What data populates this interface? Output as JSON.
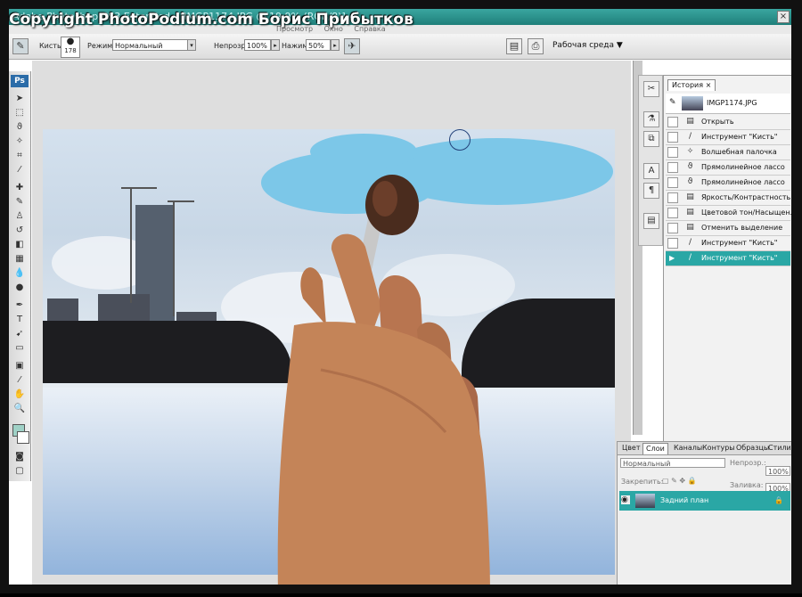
{
  "watermark": "Copyright PhotoPodium.com Борис Прибытков",
  "window": {
    "title": "Adobe Photoshop CS3 Extended - [IMGP1174.JPG @ 19,9% (RGB/8)]"
  },
  "menubar": {
    "items": [
      "Просмотр",
      "Окно",
      "Справка"
    ]
  },
  "options_bar": {
    "brush_label": "Кисть:",
    "brush_size": "178",
    "mode_label": "Режим:",
    "mode_value": "Нормальный",
    "opacity_label": "Непрозр.:",
    "opacity_value": "100%",
    "flow_label": "Нажим:",
    "flow_value": "50%",
    "workspace_label": "Рабочая среда ▼"
  },
  "toolbox": {
    "logo": "Ps"
  },
  "history_panel": {
    "tab_label": "История",
    "snapshot_name": "IMGP1174.JPG",
    "states": [
      "Открыть",
      "Инструмент \"Кисть\"",
      "Волшебная палочка",
      "Прямолинейное лассо",
      "Прямолинейное лассо",
      "Яркость/Контрастность",
      "Цветовой тон/Насыщен...",
      "Отменить выделение",
      "Инструмент \"Кисть\"",
      "Инструмент \"Кисть\""
    ],
    "selected_index": 9
  },
  "layers_panel": {
    "tabs": [
      "Цвет",
      "Слои",
      "Каналы",
      "Контуры",
      "Образцы",
      "Стили"
    ],
    "active_tab": "Слои",
    "blend_mode": "Нормальный",
    "opacity_label": "Непрозр.:",
    "opacity_value": "100%",
    "lock_label": "Закрепить:",
    "fill_label": "Заливка:",
    "fill_value": "100%",
    "layer_name": "Задний план"
  },
  "colors": {
    "accent_teal": "#2aa7a5",
    "paint_stroke": "#7cc7e8"
  }
}
